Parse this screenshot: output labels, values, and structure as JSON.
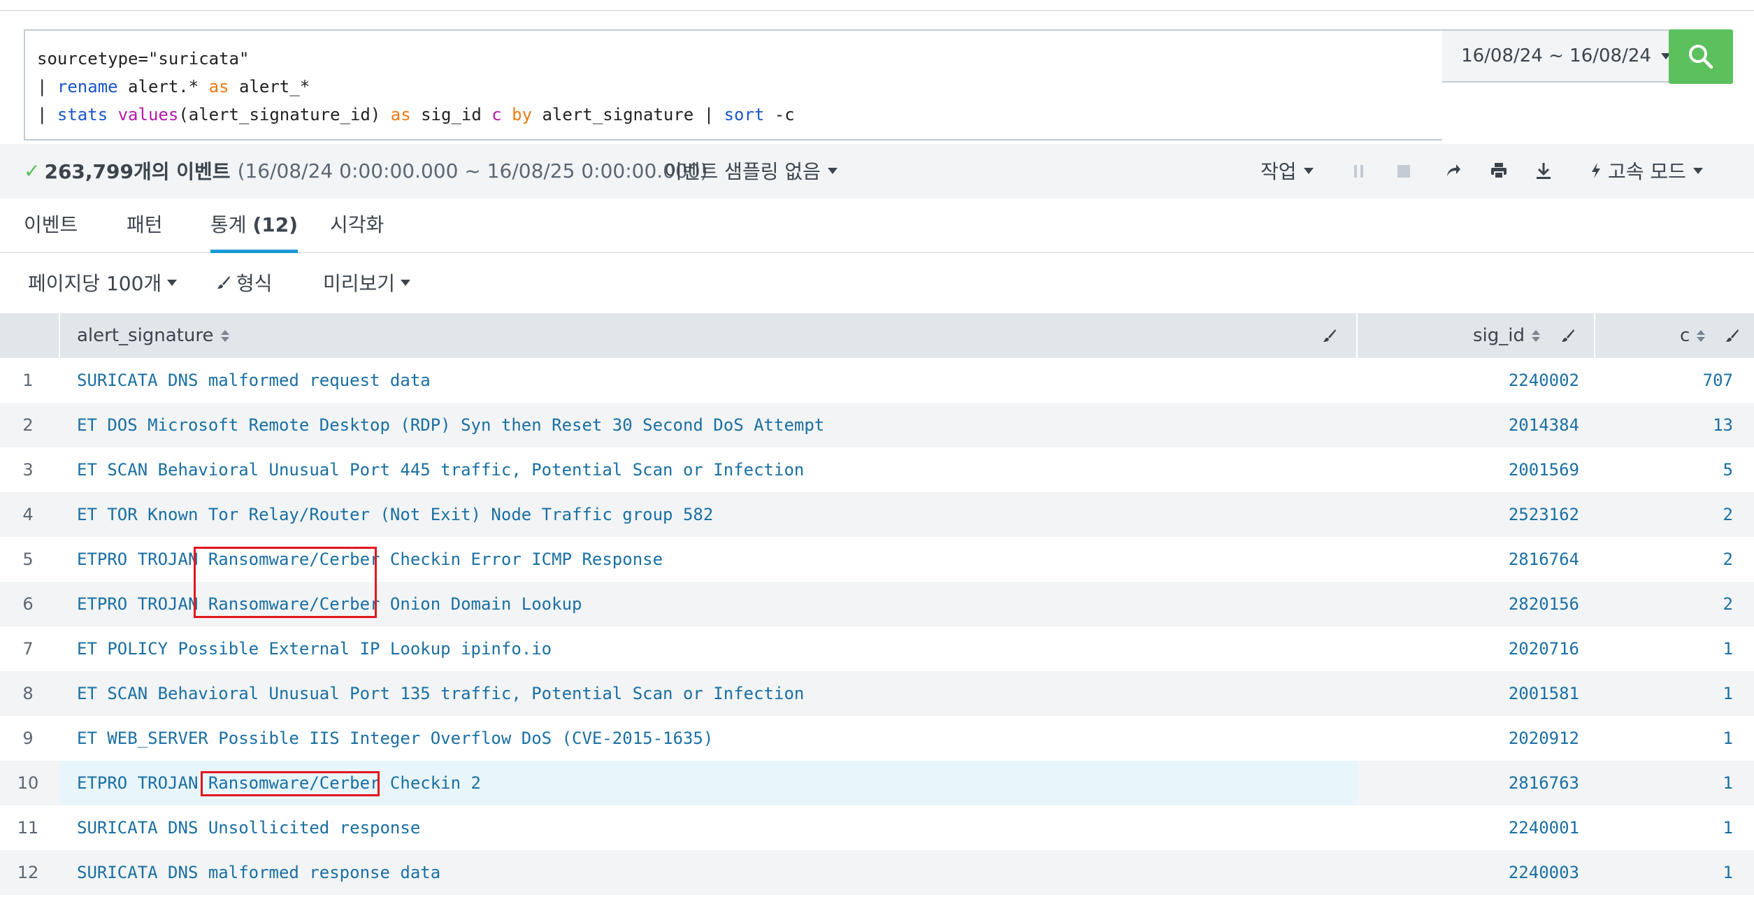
{
  "search": {
    "line1": "sourcetype=\"suricata\"",
    "line2_pipe": "| ",
    "line2_cmd": "rename",
    "line2_a": " alert.* ",
    "line2_as": "as",
    "line2_b": " alert_*",
    "line3_pipe": "| ",
    "line3_cmd": "stats",
    "line3_sp": " ",
    "line3_fn": "values",
    "line3_arg": "(alert_signature_id) ",
    "line3_as": "as",
    "line3_b": " sig_id ",
    "line3_c": "c",
    "line3_sp2": " ",
    "line3_by": "by",
    "line3_d": " alert_signature | ",
    "line3_sort": "sort",
    "line3_e": " -c",
    "time_range": "16/08/24 ~ 16/08/24"
  },
  "status": {
    "check": "✓",
    "count": "263,799개의 이벤트",
    "range": "(16/08/24 0:00:00.000 ~ 16/08/25 0:00:00.000)",
    "sampling": "이벤트 샘플링 없음",
    "job": "작업",
    "mode": "고속 모드"
  },
  "tabs": [
    {
      "label": "이벤트"
    },
    {
      "label": "패턴"
    },
    {
      "label": "통계",
      "count": "(12)"
    },
    {
      "label": "시각화"
    }
  ],
  "options": {
    "per_page": "페이지당 100개",
    "format": "형식",
    "preview": "미리보기"
  },
  "columns": {
    "signature": "alert_signature",
    "sig_id": "sig_id",
    "c": "c"
  },
  "rows": [
    {
      "n": "1",
      "sig": "SURICATA DNS malformed request data",
      "id": "2240002",
      "c": "707"
    },
    {
      "n": "2",
      "sig": "ET DOS Microsoft Remote Desktop (RDP) Syn then Reset 30 Second DoS Attempt",
      "id": "2014384",
      "c": "13"
    },
    {
      "n": "3",
      "sig": "ET SCAN Behavioral Unusual Port 445 traffic, Potential Scan or Infection",
      "id": "2001569",
      "c": "5"
    },
    {
      "n": "4",
      "sig": "ET TOR Known Tor Relay/Router (Not Exit) Node Traffic group 582",
      "id": "2523162",
      "c": "2"
    },
    {
      "n": "5",
      "sig": "ETPRO TROJAN Ransomware/Cerber Checkin Error ICMP Response",
      "id": "2816764",
      "c": "2"
    },
    {
      "n": "6",
      "sig": "ETPRO TROJAN Ransomware/Cerber Onion Domain Lookup",
      "id": "2820156",
      "c": "2"
    },
    {
      "n": "7",
      "sig": "ET POLICY Possible External IP Lookup ipinfo.io",
      "id": "2020716",
      "c": "1"
    },
    {
      "n": "8",
      "sig": "ET SCAN Behavioral Unusual Port 135 traffic, Potential Scan or Infection",
      "id": "2001581",
      "c": "1"
    },
    {
      "n": "9",
      "sig": "ET WEB_SERVER Possible IIS Integer Overflow DoS (CVE-2015-1635)",
      "id": "2020912",
      "c": "1"
    },
    {
      "n": "10",
      "sig": "ETPRO TROJAN Ransomware/Cerber Checkin 2",
      "id": "2816763",
      "c": "1"
    },
    {
      "n": "11",
      "sig": "SURICATA DNS Unsollicited response",
      "id": "2240001",
      "c": "1"
    },
    {
      "n": "12",
      "sig": "SURICATA DNS malformed response data",
      "id": "2240003",
      "c": "1"
    }
  ]
}
